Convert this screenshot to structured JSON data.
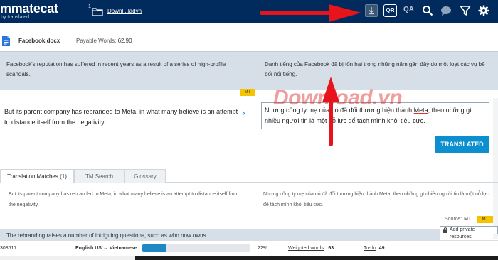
{
  "topbar": {
    "logo": "matecat",
    "logo_sub": "by translated",
    "file_count": "1",
    "download_link": "Downl...ladvn",
    "qr_label": "QR",
    "qa_label": "QA"
  },
  "file": {
    "name": "Facebook.docx",
    "payable_label": "Payable Words:",
    "payable_value": "62.90"
  },
  "prev_segment": {
    "source": "Facebook's reputation has suffered in recent years as a result of a series of high-profile scandals.",
    "target": "Danh tiếng của Facebook đã bị tổn hại trong những năm gần đây do một loạt các vụ bê bối nổi tiếng."
  },
  "active_segment": {
    "mt_tag": "MT",
    "source": "But its parent company has rebranded to Meta, in what many believe is an attempt to distance itself from the negativity.",
    "chevron": "›",
    "target_before": "Nhưng công ty mẹ của nó đã đổi thương hiệu thành ",
    "target_meta": "Meta",
    "target_after": ", theo những gì nhiều người tin là một nỗ lực để tách mình khỏi tiêu cực.",
    "translated_button": "TRANSLATED"
  },
  "watermark": "Download.vn",
  "tabs": [
    {
      "label": "Translation Matches (1)"
    },
    {
      "label": "TM Search"
    },
    {
      "label": "Glossary"
    }
  ],
  "match": {
    "source": "But its parent company has rebranded to Meta, in what many believe is an attempt to distance itself from the negativity.",
    "target": "Nhưng công ty mẹ của nó đã đổi thương hiệu thành Meta, theo những gì nhiều người tin là một nỗ lực để tách mình khỏi tiêu cực.",
    "source_label": "Source:",
    "source_value": "MT",
    "mt_tag": "MT",
    "add_private": "Add private resources"
  },
  "next_segment": {
    "source": "The rebranding raises a number of intriguing questions, such as who now owns"
  },
  "statusbar": {
    "id": "308617",
    "lang_pair": "English US → Vietnamese",
    "progress_pct": 22,
    "progress_label": "22%",
    "weighted_label": "Weighted words",
    "weighted_value": ": 63",
    "todo_label": "To-do",
    "todo_value": ": 49"
  },
  "colors": {
    "topbar": "#002b5c",
    "accent_blue": "#0b8fcf",
    "mt_yellow": "#f5c300",
    "arrow_red": "#e8141b",
    "segment_bg": "#d6dfe8"
  },
  "icons": [
    "folder-icon",
    "download-icon",
    "search-icon",
    "comment-icon",
    "filter-icon",
    "gear-icon",
    "document-icon",
    "lock-icon"
  ]
}
